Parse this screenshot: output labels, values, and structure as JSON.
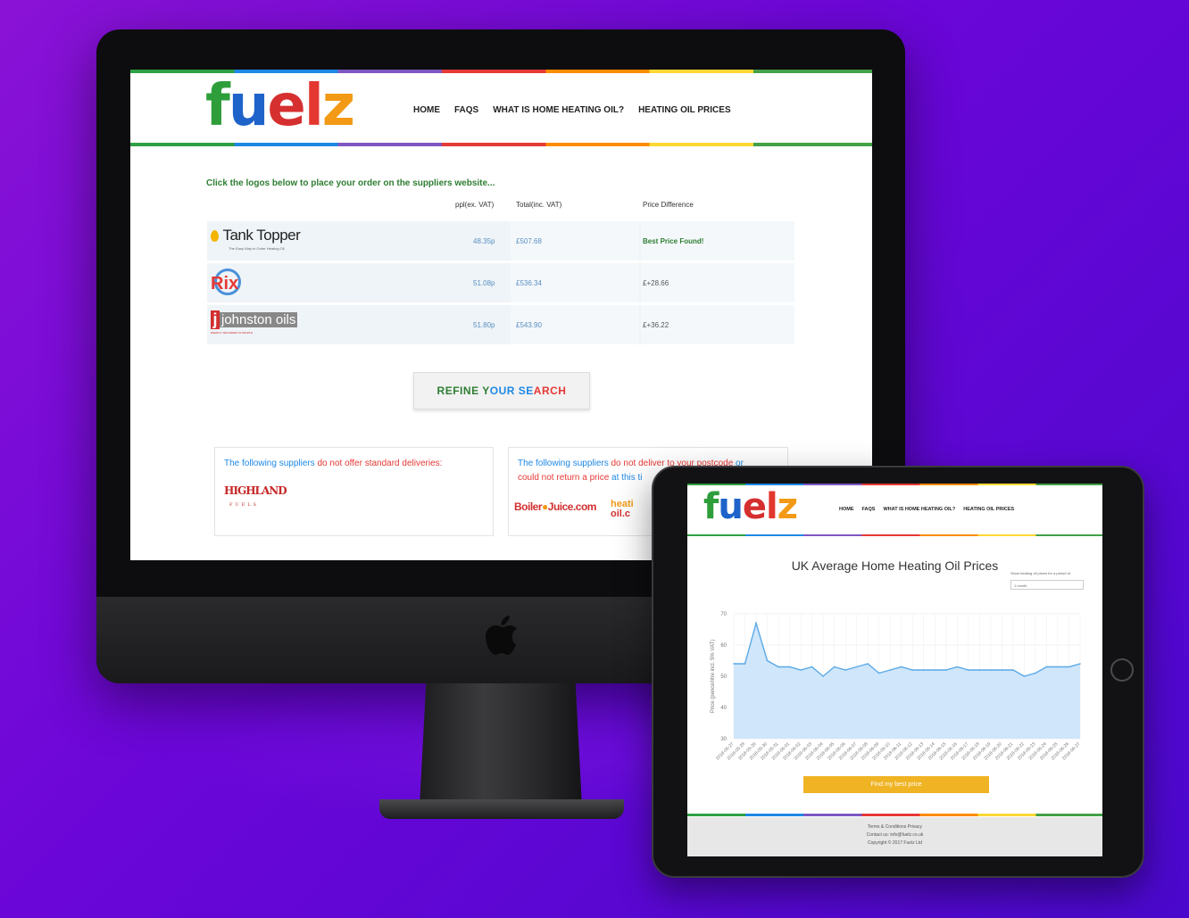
{
  "site": {
    "logo": "fuelz",
    "nav": [
      "HOME",
      "FAQS",
      "WHAT IS HOME HEATING OIL?",
      "HEATING OIL PRICES"
    ]
  },
  "results": {
    "intro": "Click the logos below to place your order on the suppliers website...",
    "columns": {
      "ppl": "ppl(ex. VAT)",
      "total": "Total(inc. VAT)",
      "diff": "Price Difference"
    },
    "suppliers": [
      {
        "name": "Tank Topper",
        "tagline": "The Easy Way to Order Heating Oil",
        "ppl": "48.35p",
        "total": "£507.68",
        "diff": "Best Price Found!"
      },
      {
        "name": "Rix",
        "tagline": "",
        "ppl": "51.08p",
        "total": "£536.34",
        "diff": "£+28.66"
      },
      {
        "name": "johnston oils",
        "tagline": "ENERGY DELIVERED IN PEOPLE",
        "ppl": "51.80p",
        "total": "£543.90",
        "diff": "£+36.22"
      }
    ],
    "refine_button": "REFINE YOUR SEARCH",
    "no_standard": {
      "pre": "The following suppliers ",
      "mid": "do not offer standard deliveries:",
      "logos": [
        "HIGHLAND",
        "FUELS"
      ]
    },
    "no_postcode": {
      "pre": "The following suppliers ",
      "mid": "do not deliver to your postcode",
      "or": " or",
      "line2a": "could not return a price",
      "line2b": " at this ti",
      "logos": [
        "Boiler",
        "Juice.com",
        "heati",
        "oil.c"
      ]
    }
  },
  "tablet": {
    "nav": [
      "HOME",
      "FAQS",
      "WHAT IS HOME HEATING OIL?",
      "HEATING OIL PRICES"
    ],
    "chart_title": "UK Average Home Heating Oil Prices",
    "period_label": "Show heating oil prices for a period of",
    "period_value": "1 month",
    "find_button": "Find my best price",
    "footer": [
      "Terms & Conditions   Privacy",
      "Contact us: info@fuelz.co.uk",
      "Copyright © 2017 Fuelz Ltd"
    ]
  },
  "chart_data": {
    "type": "area",
    "title": "UK Average Home Heating Oil Prices",
    "ylabel": "Price (pence/litre incl. 5% VAT)",
    "ylim": [
      30,
      70
    ],
    "yticks": [
      30,
      40,
      50,
      60,
      70
    ],
    "x": [
      "2018-05-27",
      "2018-05-28",
      "2018-05-29",
      "2018-05-30",
      "2018-05-31",
      "2018-06-01",
      "2018-06-02",
      "2018-06-03",
      "2018-06-04",
      "2018-06-05",
      "2018-06-06",
      "2018-06-07",
      "2018-06-08",
      "2018-06-09",
      "2018-06-10",
      "2018-06-11",
      "2018-06-12",
      "2018-06-13",
      "2018-06-14",
      "2018-06-15",
      "2018-06-16",
      "2018-06-17",
      "2018-06-18",
      "2018-06-19",
      "2018-06-20",
      "2018-06-21",
      "2018-06-22",
      "2018-06-23",
      "2018-06-24",
      "2018-06-25",
      "2018-06-26",
      "2018-06-27"
    ],
    "values": [
      54,
      54,
      67,
      55,
      53,
      53,
      52,
      53,
      50,
      53,
      52,
      53,
      54,
      51,
      52,
      53,
      52,
      52,
      52,
      52,
      53,
      52,
      52,
      52,
      52,
      52,
      50,
      51,
      53,
      53,
      53,
      54
    ],
    "color": "#5aa9e6",
    "fill": "#cfe6fb"
  },
  "colors": {
    "green": "#2e7d32",
    "blue": "#1e88e5",
    "red": "#e53935",
    "orange": "#fb8c00",
    "button": "#f0b323"
  }
}
